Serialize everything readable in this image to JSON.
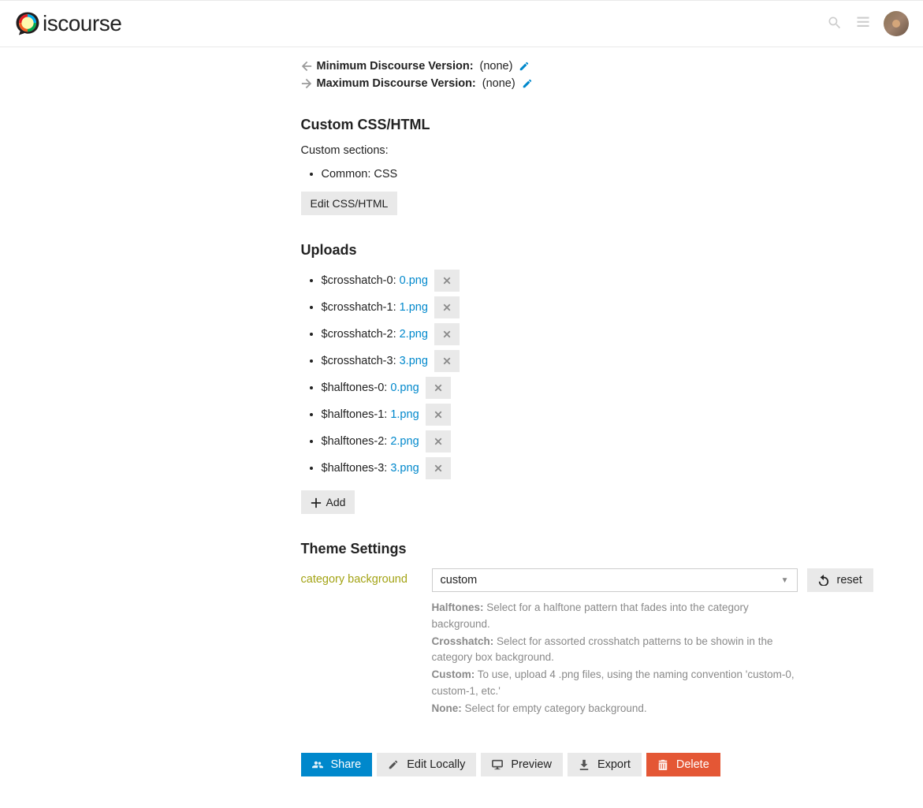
{
  "header": {
    "logo_text": "iscourse"
  },
  "versions": {
    "min_label": "Minimum Discourse Version:",
    "min_value": "(none)",
    "max_label": "Maximum Discourse Version:",
    "max_value": "(none)"
  },
  "css_section": {
    "heading": "Custom CSS/HTML",
    "subtitle": "Custom sections:",
    "items": [
      "Common: CSS"
    ],
    "edit_button": "Edit CSS/HTML"
  },
  "uploads": {
    "heading": "Uploads",
    "items": [
      {
        "name": "$crosshatch-0:",
        "file": "0.png"
      },
      {
        "name": "$crosshatch-1:",
        "file": "1.png"
      },
      {
        "name": "$crosshatch-2:",
        "file": "2.png"
      },
      {
        "name": "$crosshatch-3:",
        "file": "3.png"
      },
      {
        "name": "$halftones-0:",
        "file": "0.png"
      },
      {
        "name": "$halftones-1:",
        "file": "1.png"
      },
      {
        "name": "$halftones-2:",
        "file": "2.png"
      },
      {
        "name": "$halftones-3:",
        "file": "3.png"
      }
    ],
    "add_button": "Add"
  },
  "theme_settings": {
    "heading": "Theme Settings",
    "label": "category background",
    "selected": "custom",
    "reset": "reset",
    "descriptions": [
      {
        "key": "Halftones:",
        "text": " Select for a halftone pattern that fades into the category background."
      },
      {
        "key": "Crosshatch:",
        "text": " Select for assorted crosshatch patterns to be showin in the category box background."
      },
      {
        "key": "Custom:",
        "text": " To use, upload 4 .png files, using the naming convention 'custom-0, custom-1, etc.'"
      },
      {
        "key": "None:",
        "text": " Select for empty category background."
      }
    ]
  },
  "actions": {
    "share": "Share",
    "edit_locally": "Edit Locally",
    "preview": "Preview",
    "export": "Export",
    "delete": "Delete"
  }
}
